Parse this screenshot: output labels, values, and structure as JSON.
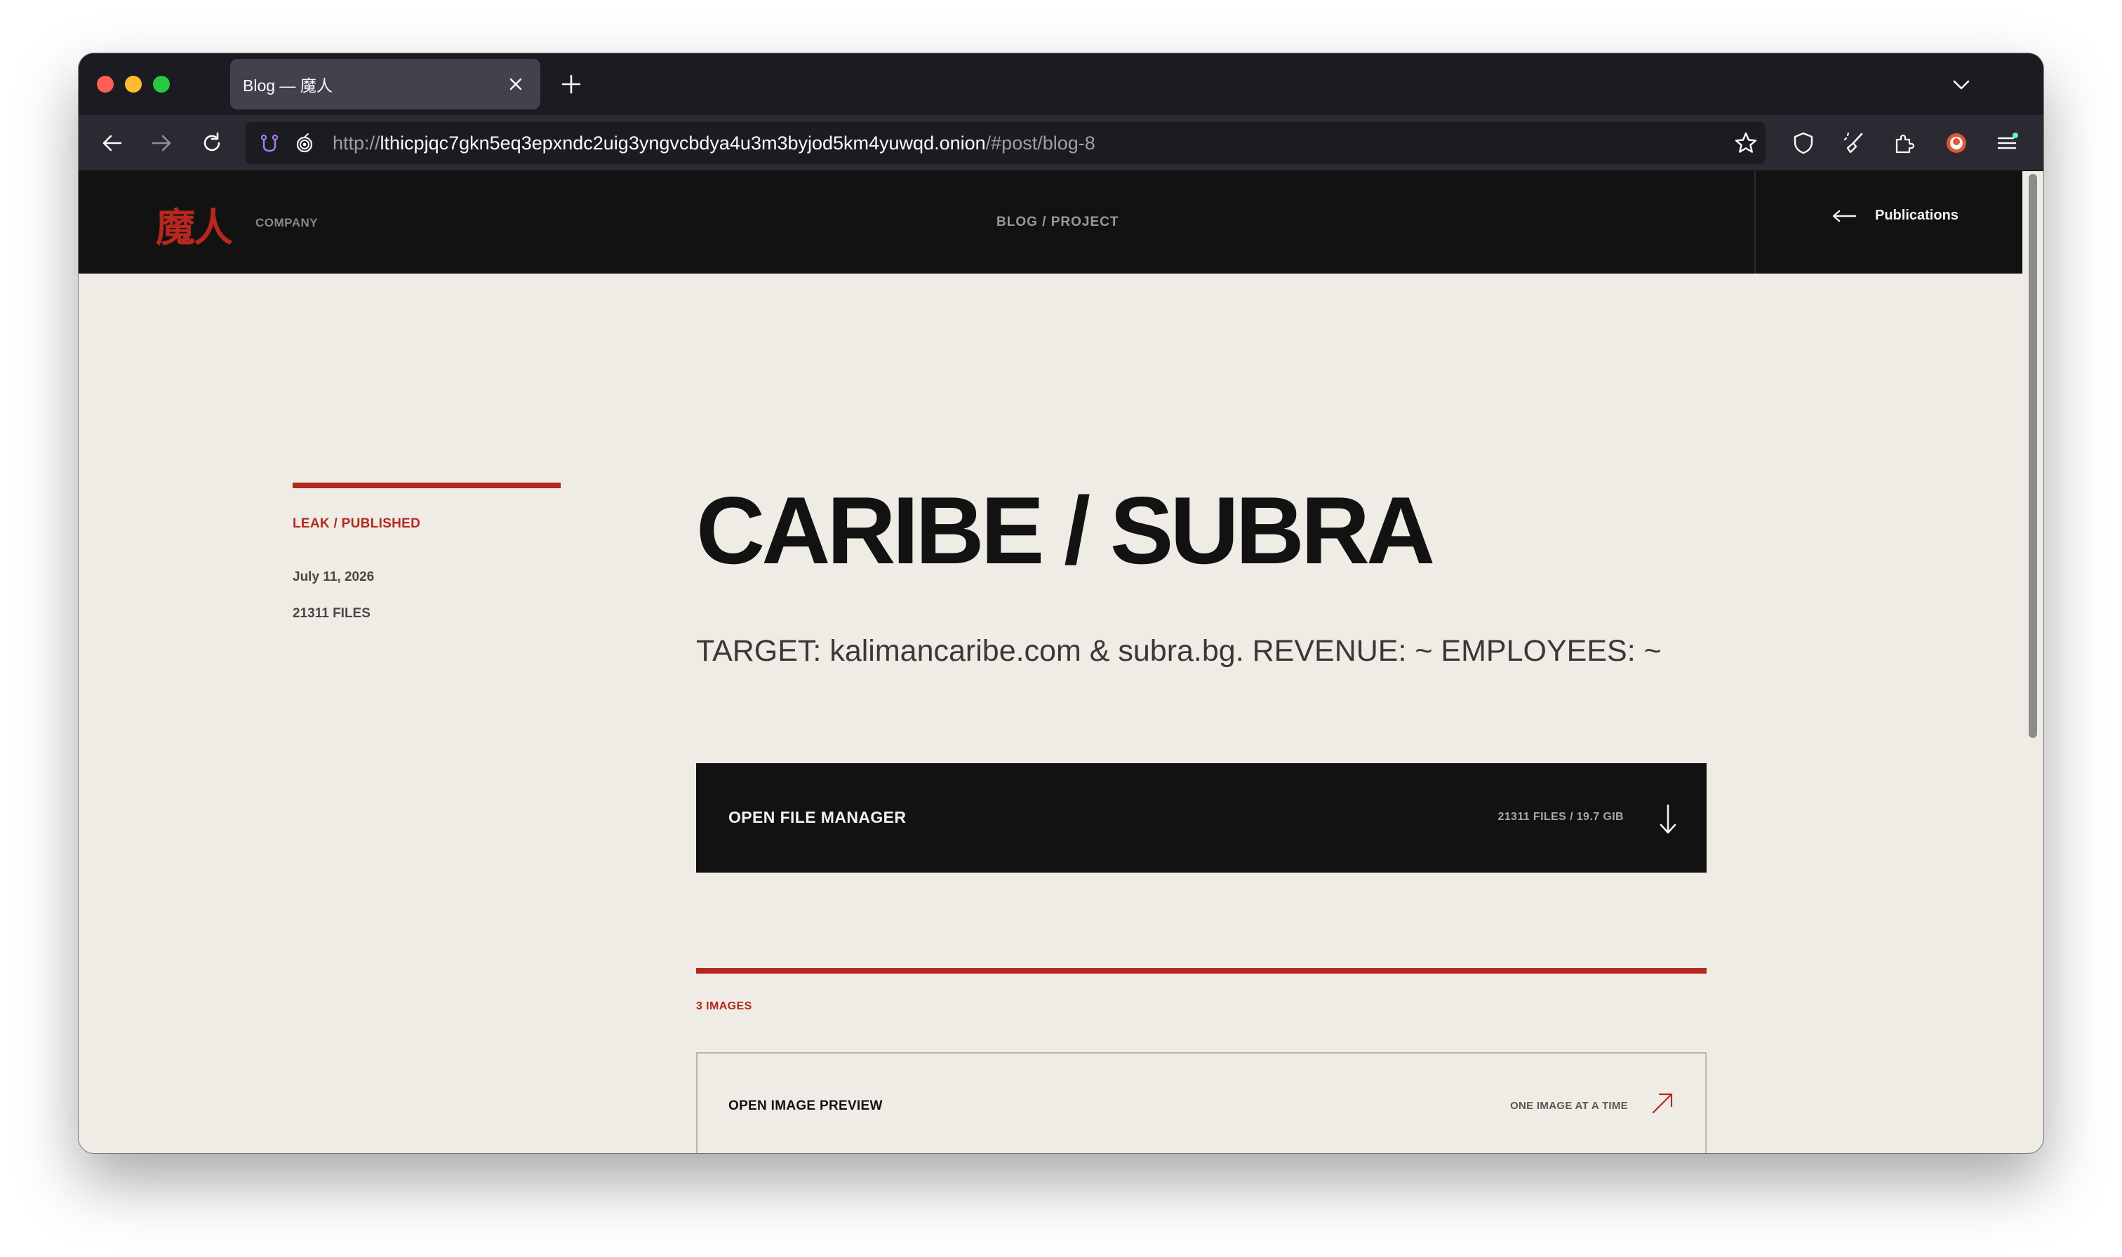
{
  "browser": {
    "tab_title": "Blog — 魔人",
    "url_scheme": "http://",
    "url_host": "lthicpjqc7gkn5eq3epxndc2uig3yngvcbdya4u3m3byjod5km4yuwqd.onion",
    "url_fragment": "/#post/blog-8"
  },
  "site": {
    "logo": "魔人",
    "company_label": "COMPANY",
    "breadcrumb": "BLOG / PROJECT",
    "publications_label": "Publications"
  },
  "post": {
    "status": "LEAK / PUBLISHED",
    "date": "July 11, 2026",
    "files_count": "21311 FILES",
    "title": "CARIBE / SUBRA",
    "subtitle": "TARGET: kalimancaribe.com & subra.bg. REVENUE: ~ EMPLOYEES: ~",
    "file_manager": {
      "label": "OPEN FILE MANAGER",
      "meta": "21311 FILES / 19.7 GIB"
    },
    "images_section": {
      "label": "3 IMAGES",
      "preview_label": "OPEN IMAGE PREVIEW",
      "preview_meta": "ONE IMAGE AT A TIME"
    }
  },
  "colors": {
    "accent": "#b5281e",
    "header_bg": "#121212",
    "page_bg": "#efece5"
  }
}
